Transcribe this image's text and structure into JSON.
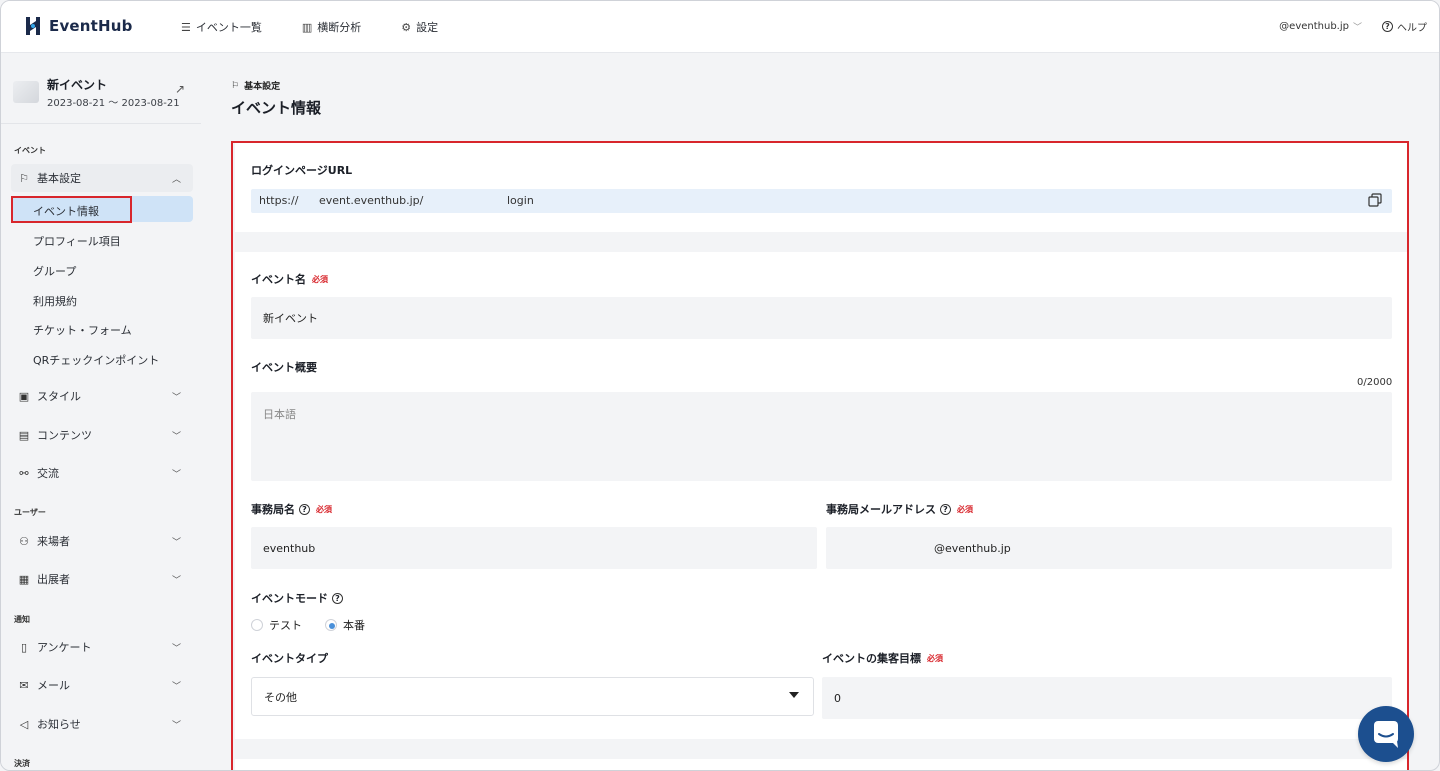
{
  "header": {
    "logo_text": "EventHub",
    "nav": [
      {
        "icon": "list-icon",
        "label": "イベント一覧"
      },
      {
        "icon": "bar-chart-icon",
        "label": "横断分析"
      },
      {
        "icon": "gear-icon",
        "label": "設定"
      }
    ],
    "account": "@eventhub.jp",
    "help": "ヘルプ"
  },
  "sidebar": {
    "event": {
      "name": "新イベント",
      "dates": "2023-08-21 〜 2023-08-21"
    },
    "sections": {
      "event": "イベント",
      "user": "ユーザー",
      "notify": "通知",
      "payment": "決済"
    },
    "basic_settings": "基本設定",
    "sub_items": [
      "イベント情報",
      "プロフィール項目",
      "グループ",
      "利用規約",
      "チケット・フォーム",
      "QRチェックインポイント"
    ],
    "menu": {
      "style": "スタイル",
      "contents": "コンテンツ",
      "exchange": "交流",
      "visitors": "来場者",
      "exhibitors": "出展者",
      "survey": "アンケート",
      "mail": "メール",
      "notice": "お知らせ"
    }
  },
  "main": {
    "breadcrumb": "基本設定",
    "title": "イベント情報",
    "login_url": {
      "label": "ログインページURL",
      "prefix": "https://",
      "domain": "event.eventhub.jp/",
      "suffix": "login"
    },
    "required": "必須",
    "event_name": {
      "label": "イベント名",
      "value": "新イベント"
    },
    "event_summary": {
      "label": "イベント概要",
      "counter": "0/2000",
      "placeholder": "日本語"
    },
    "office_name": {
      "label": "事務局名",
      "value": "eventhub"
    },
    "office_email": {
      "label": "事務局メールアドレス",
      "value": "@eventhub.jp"
    },
    "event_mode": {
      "label": "イベントモード",
      "options": [
        "テスト",
        "本番"
      ],
      "selected": "本番"
    },
    "event_type": {
      "label": "イベントタイプ",
      "value": "その他"
    },
    "attendance_goal": {
      "label": "イベントの集客目標",
      "value": "0"
    }
  }
}
